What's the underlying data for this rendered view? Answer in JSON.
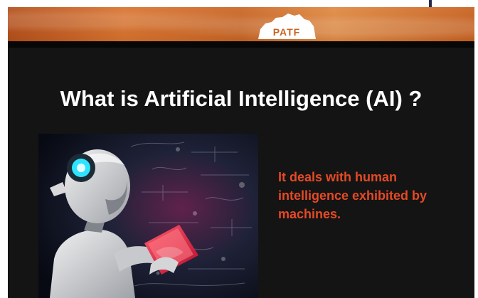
{
  "slide": {
    "brand_logo_text": "PATF",
    "title": "What is Artificial Intelligence (AI) ?",
    "description": "It deals with human intelligence exhibited by machines."
  },
  "colors": {
    "banner": "#d9732e",
    "slide_background": "#141414",
    "title": "#ffffff",
    "description": "#e54a25",
    "screen_chrome": "#ffffff"
  },
  "icons": {
    "logo": "patf-map-logo-icon",
    "illustration": "robot-reading-tablet-icon"
  }
}
